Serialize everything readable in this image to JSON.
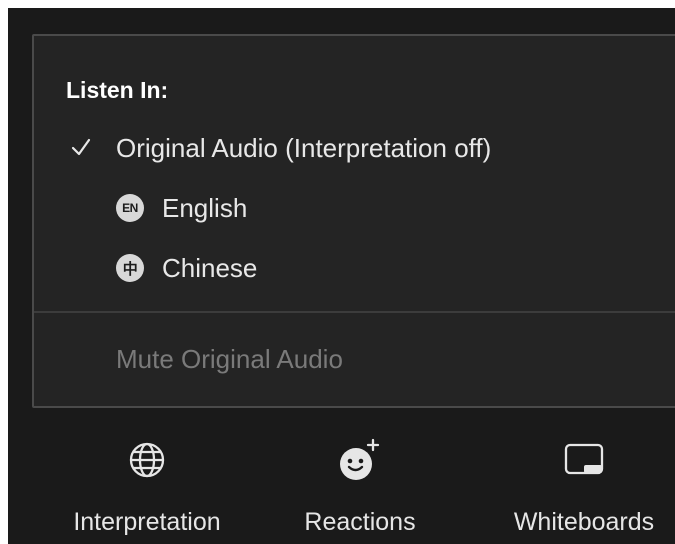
{
  "listen_menu": {
    "title": "Listen In:",
    "items": [
      {
        "label": "Original Audio (Interpretation off)",
        "checked": true
      },
      {
        "badge": "EN",
        "label": "English",
        "checked": false
      },
      {
        "badge": "中",
        "label": "Chinese",
        "checked": false
      }
    ],
    "mute_label": "Mute Original Audio"
  },
  "toolbar": {
    "interpretation_label": "Interpretation",
    "interpretation_icon": "globe-icon",
    "reactions_label": "Reactions",
    "reactions_icon": "emoji-add-icon",
    "whiteboards_label": "Whiteboards",
    "whiteboards_icon": "whiteboard-icon"
  },
  "colors": {
    "background": "#1a1a1a",
    "popup": "#242424",
    "text": "#e8e8e8",
    "disabled": "#7a7a7a"
  }
}
